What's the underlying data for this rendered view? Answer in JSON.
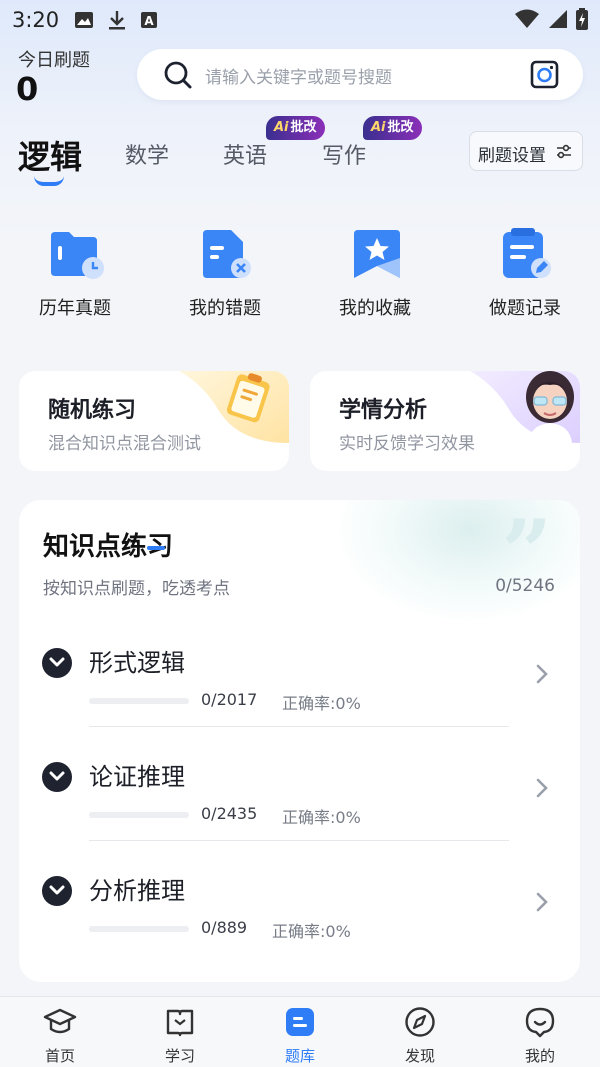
{
  "status_bar": {
    "time": "3:20"
  },
  "header": {
    "today_label": "今日刷题",
    "today_count": "0",
    "search_placeholder": "请输入关键字或题号搜题"
  },
  "tabs": [
    {
      "label": "逻辑",
      "active": true
    },
    {
      "label": "数学",
      "active": false
    },
    {
      "label": "英语",
      "active": false,
      "badge": "批改"
    },
    {
      "label": "写作",
      "active": false,
      "badge": "批改"
    }
  ],
  "badge_prefix": "Ai",
  "settings_label": "刷题设置",
  "quick_actions": [
    {
      "label": "历年真题",
      "icon": "folder-clock-icon"
    },
    {
      "label": "我的错题",
      "icon": "wrong-file-icon"
    },
    {
      "label": "我的收藏",
      "icon": "star-bookmark-icon"
    },
    {
      "label": "做题记录",
      "icon": "record-edit-icon"
    }
  ],
  "promos": [
    {
      "title": "随机练习",
      "subtitle": "混合知识点混合测试"
    },
    {
      "title": "学情分析",
      "subtitle": "实时反馈学习效果"
    }
  ],
  "knowledge": {
    "title": "知识点练习",
    "subtitle": "按知识点刷题，吃透考点",
    "count": "0/5246",
    "rows": [
      {
        "name": "形式逻辑",
        "progress": "0/2017",
        "accuracy": "正确率:0%"
      },
      {
        "name": "论证推理",
        "progress": "0/2435",
        "accuracy": "正确率:0%"
      },
      {
        "name": "分析推理",
        "progress": "0/889",
        "accuracy": "正确率:0%"
      }
    ]
  },
  "bottom_nav": [
    {
      "label": "首页",
      "icon": "graduation-cap-icon"
    },
    {
      "label": "学习",
      "icon": "book-icon"
    },
    {
      "label": "题库",
      "icon": "question-bank-icon",
      "active": true
    },
    {
      "label": "发现",
      "icon": "compass-icon"
    },
    {
      "label": "我的",
      "icon": "profile-face-icon"
    }
  ],
  "colors": {
    "accent": "#2e7cf6",
    "badge_gradient": [
      "#3a2f8f",
      "#8b2fb8"
    ]
  }
}
